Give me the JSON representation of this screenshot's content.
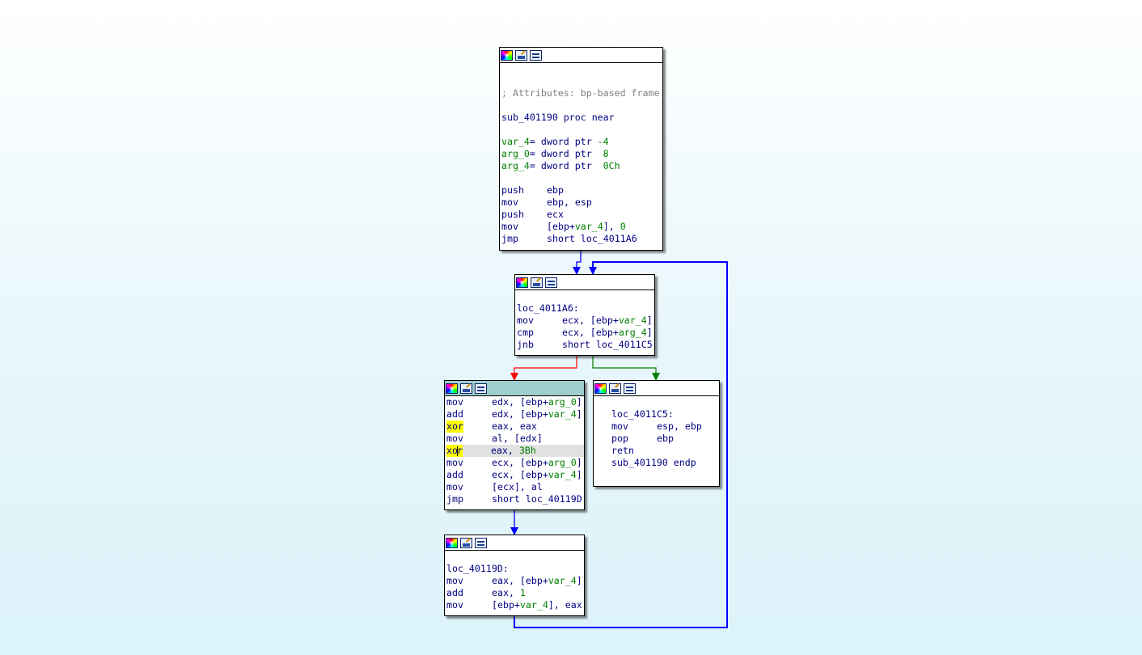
{
  "edge_colors": {
    "unconditional": "#0000ff",
    "false_branch": "#ff0000",
    "true_branch": "#008000"
  },
  "toolbar_icons": [
    "colors-icon",
    "rename-icon",
    "graph-overview-icon"
  ],
  "blocks": {
    "entry": {
      "comment": "; Attributes: bp-based frame",
      "proc_name": "sub_401190",
      "proc_decl": "proc near",
      "vars": [
        {
          "name": "var_4",
          "decl": "= dword ptr ",
          "value": "-4"
        },
        {
          "name": "arg_0",
          "decl": "= dword ptr  ",
          "value": "8"
        },
        {
          "name": "arg_4",
          "decl": "= dword ptr  ",
          "value": "0Ch"
        }
      ],
      "instr": [
        {
          "mn": "push",
          "ops": "ebp"
        },
        {
          "mn": "mov",
          "ops": "ebp, esp"
        },
        {
          "mn": "push",
          "ops": "ecx"
        },
        {
          "mn": "mov",
          "pre": "[ebp+",
          "var": "var_4",
          "post": "], ",
          "num": "0"
        },
        {
          "mn": "jmp",
          "ops": "short loc_4011A6"
        }
      ]
    },
    "loop_head": {
      "label": "loc_4011A6:",
      "instr": [
        {
          "mn": "mov",
          "pre": "ecx, [ebp+",
          "var": "var_4",
          "post": "]"
        },
        {
          "mn": "cmp",
          "pre": "ecx, [ebp+",
          "var": "arg_4",
          "post": "]"
        },
        {
          "mn": "jnb",
          "ops": "short loc_4011C5"
        }
      ]
    },
    "loop_body": {
      "instr": [
        {
          "mn": "mov",
          "pre": "edx, [ebp+",
          "var": "arg_0",
          "post": "]"
        },
        {
          "mn": "add",
          "pre": "edx, [ebp+",
          "var": "var_4",
          "post": "]"
        },
        {
          "mn": "xor",
          "ops": "eax, eax"
        },
        {
          "mn": "mov",
          "ops": "al, [edx]"
        },
        {
          "mn_a": "xo",
          "mn_b": "r",
          "pre": "eax, ",
          "num": "3Bh"
        },
        {
          "mn": "mov",
          "pre": "ecx, [ebp+",
          "var": "arg_0",
          "post": "]"
        },
        {
          "mn": "add",
          "pre": "ecx, [ebp+",
          "var": "var_4",
          "post": "]"
        },
        {
          "mn": "mov",
          "ops": "[ecx], al"
        },
        {
          "mn": "jmp",
          "ops": "short loc_40119D"
        }
      ]
    },
    "exit": {
      "label": "loc_4011C5:",
      "instr": [
        {
          "mn": "mov",
          "ops": "esp, ebp"
        },
        {
          "mn": "pop",
          "ops": "ebp"
        },
        {
          "mn": "retn",
          "ops": ""
        },
        {
          "mn": "sub_401190 endp",
          "ops": ""
        }
      ]
    },
    "increment": {
      "label": "loc_40119D:",
      "instr": [
        {
          "mn": "mov",
          "pre": "eax, [ebp+",
          "var": "var_4",
          "post": "]"
        },
        {
          "mn": "add",
          "pre": "eax, ",
          "num": "1"
        },
        {
          "mn": "mov",
          "pre": "[ebp+",
          "var": "var_4",
          "post": "], eax"
        }
      ]
    }
  }
}
